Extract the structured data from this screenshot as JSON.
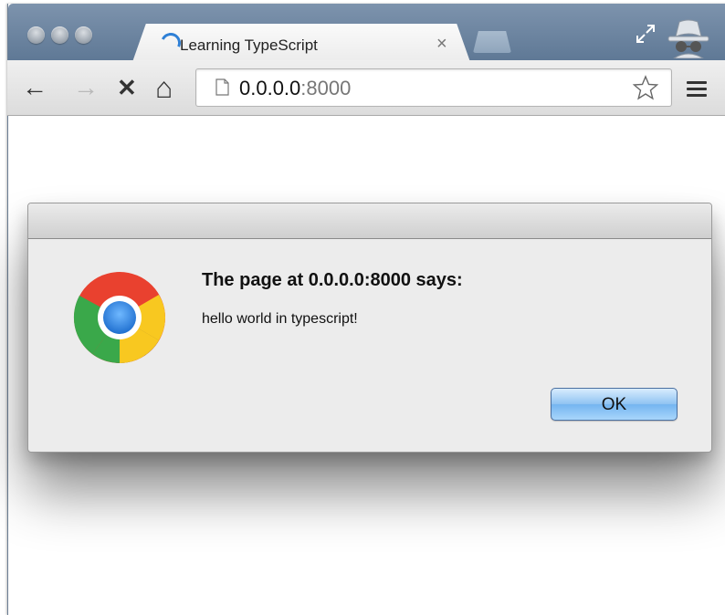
{
  "browser": {
    "tab": {
      "title": "Learning TypeScript",
      "close_glyph": "×"
    },
    "toolbar": {
      "back_glyph": "←",
      "forward_glyph": "→",
      "stop_glyph": "✕",
      "home_glyph": "⌂",
      "url_host": "0.0.0.0",
      "url_port": ":8000"
    },
    "icons": [
      "traffic-light-icon",
      "loading-spinner-icon",
      "fullscreen-icon",
      "incognito-icon",
      "page-icon",
      "star-icon",
      "menu-icon"
    ]
  },
  "dialog": {
    "heading": "The page at 0.0.0.0:8000 says:",
    "message": "hello world in typescript!",
    "ok_label": "OK",
    "icon": "chrome-logo-icon"
  },
  "colors": {
    "tabstrip": "#6d859f",
    "spinner": "#2f80d6",
    "ok_button": "#8fc3f2",
    "dialog_bg": "#ececec"
  }
}
